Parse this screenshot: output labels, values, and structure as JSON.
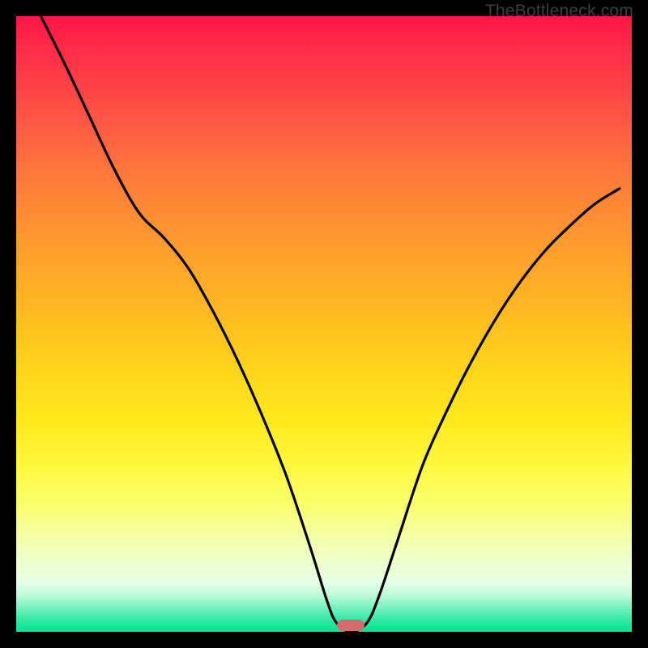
{
  "watermark": "TheBottleneck.com",
  "marker": {
    "x_frac": 0.544,
    "y_frac": 0.989,
    "color": "#d66b6f"
  },
  "chart_data": {
    "type": "line",
    "title": "",
    "xlabel": "",
    "ylabel": "",
    "xlim": [
      0,
      1
    ],
    "ylim": [
      0,
      1
    ],
    "y_is_inverted_from_top": false,
    "note": "Curve is a V-shaped bottleneck plot. y represents bottleneck fraction (1 = 100% red at top, 0 = green at bottom). Minimum near x≈0.54.",
    "series": [
      {
        "name": "bottleneck-curve",
        "x": [
          0.04,
          0.08,
          0.12,
          0.16,
          0.2,
          0.24,
          0.28,
          0.32,
          0.36,
          0.4,
          0.44,
          0.48,
          0.505,
          0.52,
          0.544,
          0.57,
          0.59,
          0.62,
          0.66,
          0.7,
          0.74,
          0.78,
          0.82,
          0.86,
          0.9,
          0.94,
          0.98
        ],
        "y": [
          1.0,
          0.92,
          0.835,
          0.75,
          0.68,
          0.64,
          0.59,
          0.52,
          0.44,
          0.35,
          0.25,
          0.13,
          0.05,
          0.015,
          0.0,
          0.015,
          0.06,
          0.15,
          0.27,
          0.36,
          0.44,
          0.51,
          0.57,
          0.62,
          0.66,
          0.695,
          0.72
        ]
      }
    ],
    "background_gradient_stops": [
      {
        "pos": 0.0,
        "color": "#ff1647"
      },
      {
        "pos": 0.5,
        "color": "#ffd61a"
      },
      {
        "pos": 0.8,
        "color": "#f4ffa0"
      },
      {
        "pos": 1.0,
        "color": "#00e58f"
      }
    ]
  }
}
